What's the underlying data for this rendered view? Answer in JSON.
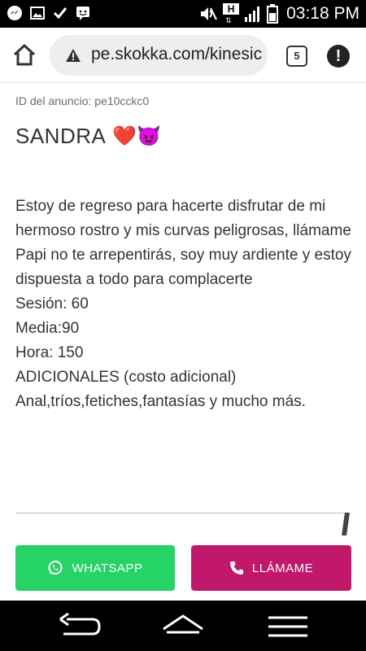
{
  "status_bar": {
    "time": "03:18 PM",
    "notification_icons": [
      "messenger-icon",
      "gallery-icon",
      "check-icon",
      "chat-icon"
    ],
    "system_icons": [
      "mute-icon",
      "hplus-icon",
      "signal-icon",
      "battery-icon"
    ],
    "network_label": "H"
  },
  "browser": {
    "url": "pe.skokka.com/kinesic",
    "tab_count": "5",
    "menu_glyph": "!"
  },
  "ad": {
    "id_label": "ID del anuncio: pe10cckc0",
    "name": "SANDRA",
    "name_emojis": "❤️😈",
    "description_lines": [
      "Estoy de regreso para hacerte disfrutar de mi hermoso rostro y mis curvas peligrosas, llámame Papi no te arrepentirás, soy muy ardiente y estoy dispuesta a todo para complacerte",
      "Sesión: 60",
      "Media:90",
      "Hora: 150",
      "ADICIONALES (costo adicional)",
      "Anal,tríos,fetiches,fantasías y mucho más."
    ]
  },
  "actions": {
    "whatsapp_label": "WHATSAPP",
    "call_label": "LLÁMAME"
  },
  "colors": {
    "whatsapp": "#25d366",
    "call": "#c2186c",
    "text": "#333333"
  }
}
